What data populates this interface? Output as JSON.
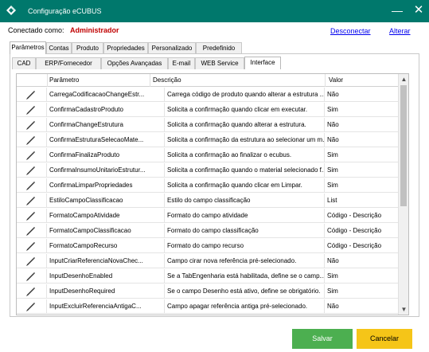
{
  "window": {
    "title": "Configuração eCUBUS",
    "minimize_glyph": "—",
    "close_glyph": "✕"
  },
  "connection": {
    "label": "Conectado como:",
    "user": "Administrador",
    "disconnect": "Desconectar",
    "change": "Alterar"
  },
  "main_tabs": [
    "Parâmetros",
    "Contas",
    "Produto",
    "Propriedades",
    "Personalizado",
    "Predefinido"
  ],
  "main_tab_active": "Parâmetros",
  "sub_tabs": [
    "CAD",
    "ERP/Fornecedor",
    "Opções Avançadas",
    "E-mail",
    "WEB Service",
    "Interface"
  ],
  "sub_tab_active": "Interface",
  "grid": {
    "columns": [
      "",
      "Parâmetro",
      "Descrição",
      "Valor"
    ],
    "rows": [
      {
        "param": "CarregaCodificacaoChangeEstr...",
        "desc": "Carrega código de produto quando alterar a estrutura ...",
        "value": "Não"
      },
      {
        "param": "ConfirmaCadastroProduto",
        "desc": "Solicita a confirmação quando clicar em executar.",
        "value": "Sim"
      },
      {
        "param": "ConfirmaChangeEstrutura",
        "desc": "Solicita a confirmação quando alterar a estrutura.",
        "value": "Não"
      },
      {
        "param": "ConfirmaEstruturaSelecaoMate...",
        "desc": "Solicita a confirmação da estrutura ao selecionar um m...",
        "value": "Não"
      },
      {
        "param": "ConfirmaFinalizaProduto",
        "desc": "Solicita a confirmação ao finalizar o ecubus.",
        "value": "Sim"
      },
      {
        "param": "ConfirmaInsumoUnitarioEstrutur...",
        "desc": "Solicita a confirmação quando o material selecionado f...",
        "value": "Sim"
      },
      {
        "param": "ConfirmaLimparPropriedades",
        "desc": "Solicita a confirmação quando clicar em Limpar.",
        "value": "Sim"
      },
      {
        "param": "EstiloCampoClassificacao",
        "desc": "Estilo do campo classificação",
        "value": "List"
      },
      {
        "param": "FormatoCampoAtividade",
        "desc": "Formato do campo atividade",
        "value": "Código - Descrição"
      },
      {
        "param": "FormatoCampoClassificacao",
        "desc": "Formato do campo classificação",
        "value": "Código - Descrição"
      },
      {
        "param": "FormatoCampoRecurso",
        "desc": "Formato do campo recurso",
        "value": "Código - Descrição"
      },
      {
        "param": "InputCriarReferenciaNovaChec...",
        "desc": "Campo cirar nova referência pré-selecionado.",
        "value": "Não"
      },
      {
        "param": "InputDesenhoEnabled",
        "desc": "Se a TabEngenharia está habilitada, define se o camp...",
        "value": "Sim"
      },
      {
        "param": "InputDesenhoRequired",
        "desc": "Se o campo Desenho está ativo, define se obrigatório.",
        "value": "Sim"
      },
      {
        "param": "InputExcluirReferenciaAntigaC...",
        "desc": "Campo apagar referência antiga pré-selecionado.",
        "value": "Não"
      }
    ]
  },
  "buttons": {
    "save": "Salvar",
    "cancel": "Cancelar"
  },
  "colors": {
    "titlebar": "#00786c",
    "save": "#4caf50",
    "cancel": "#f5c518",
    "user": "#c00000"
  },
  "icons": {
    "edit": "pencil-icon",
    "logo": "ecubus-logo-icon"
  }
}
